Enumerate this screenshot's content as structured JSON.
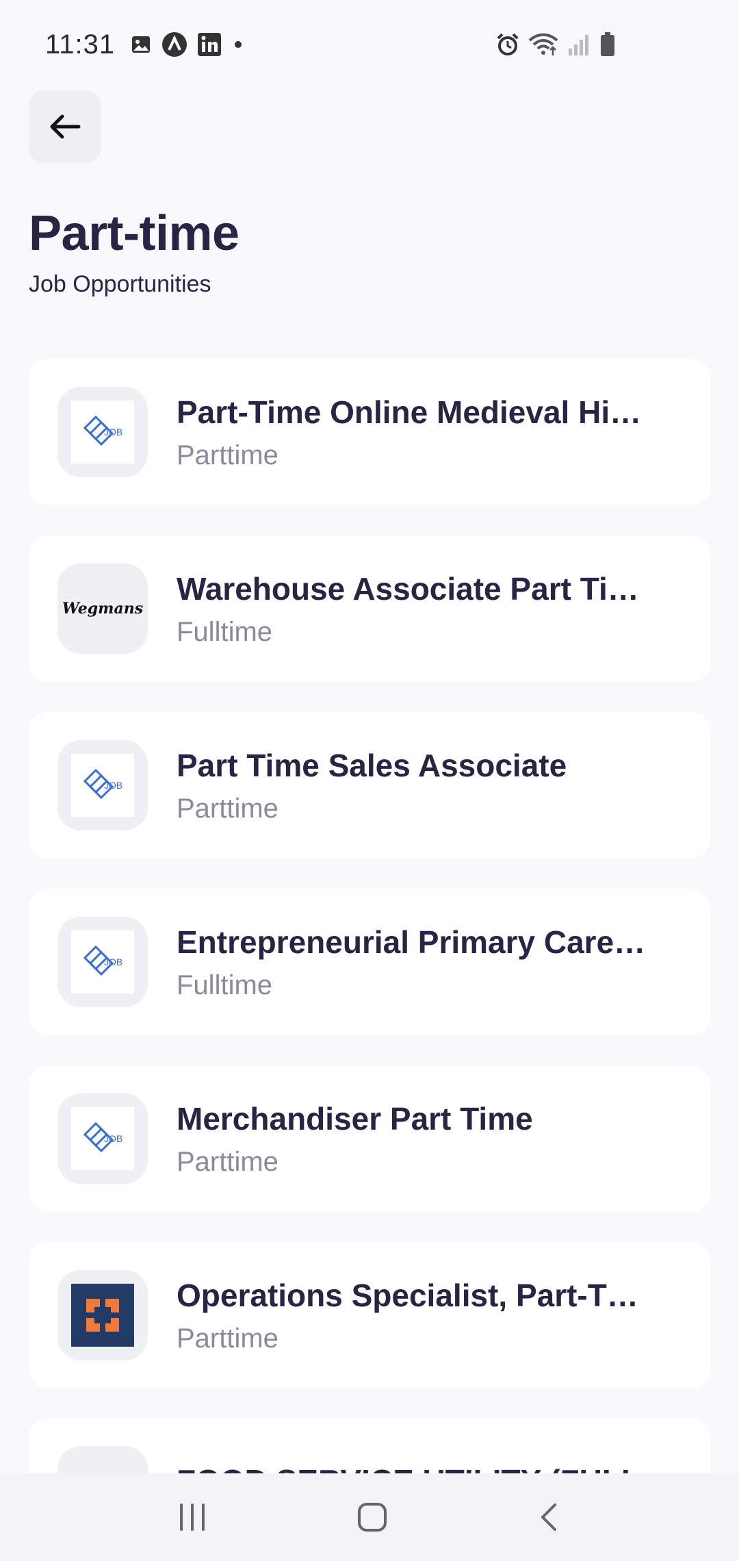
{
  "status_bar": {
    "time": "11:31",
    "left_icons": [
      "image-icon",
      "a-circle-icon",
      "linkedin-icon",
      "dot-icon"
    ],
    "right_icons": [
      "alarm-icon",
      "wifi-icon",
      "signal-icon",
      "battery-icon"
    ]
  },
  "header": {
    "back_icon": "arrow-left-icon",
    "title": "Part-time",
    "subtitle": "Job Opportunities"
  },
  "jobs": [
    {
      "title": "Part-Time Online Medieval Hi…",
      "type": "Parttime",
      "logo": "job-logo"
    },
    {
      "title": "Warehouse Associate Part Ti…",
      "type": "Fulltime",
      "logo": "wegmans-logo",
      "logo_text": "Wegmans"
    },
    {
      "title": "Part Time Sales Associate",
      "type": "Parttime",
      "logo": "job-logo"
    },
    {
      "title": "Entrepreneurial Primary Care…",
      "type": "Fulltime",
      "logo": "job-logo"
    },
    {
      "title": "Merchandiser Part Time",
      "type": "Parttime",
      "logo": "job-logo"
    },
    {
      "title": "Operations Specialist, Part-T…",
      "type": "Parttime",
      "logo": "company-square-logo"
    },
    {
      "title": "FOOD SERVICE UTILITY (FULL",
      "type": "",
      "logo": "job-logo"
    }
  ],
  "logo_labels": {
    "job": "JOB"
  },
  "colors": {
    "background": "#f8f9fc",
    "title": "#262543",
    "subtle_text": "#8a8a9a",
    "job_logo_blue": "#3a6fd0",
    "ops_logo_bg": "#243a66",
    "ops_logo_accent": "#f07a3a"
  },
  "nav_bar": {
    "icons": [
      "recent-apps-icon",
      "home-icon",
      "back-icon"
    ]
  }
}
